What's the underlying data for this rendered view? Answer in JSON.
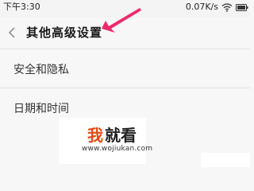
{
  "status_bar": {
    "time": "下午3:30",
    "net_speed": "0.07K/s",
    "wifi_icon": "wifi-icon",
    "battery_icon": "battery-icon"
  },
  "header": {
    "back_icon": "chevron-left-icon",
    "title": "其他高级设置"
  },
  "annotation": {
    "arrow_color": "#ee2a6a"
  },
  "list": {
    "items": [
      {
        "label": "安全和隐私"
      },
      {
        "label": "日期和时间"
      }
    ]
  },
  "watermark": {
    "logo_part1": "我",
    "logo_part2": "就看",
    "url": "www.wojiukan.com"
  },
  "colors": {
    "background": "#f7f7f7",
    "title_text": "#1a1a1a",
    "accent_arrow": "#ee2a6a",
    "logo_orange": "#e04a14"
  }
}
